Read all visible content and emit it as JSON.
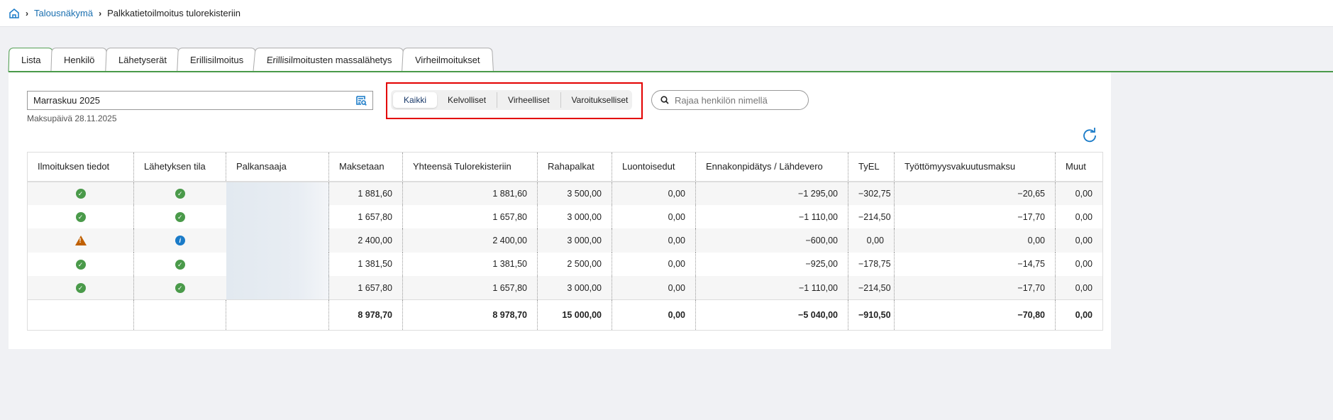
{
  "breadcrumb": {
    "home_icon": "home-icon",
    "parent": "Talousnäkymä",
    "current": "Palkkatietoilmoitus tulorekisteriin"
  },
  "tabs": [
    "Lista",
    "Henkilö",
    "Lähetyserät",
    "Erillisilmoitus",
    "Erillisilmoitusten massalähetys",
    "Virheilmoitukset"
  ],
  "period": {
    "value": "Marraskuu 2025",
    "payday": "Maksupäivä 28.11.2025"
  },
  "filters": [
    "Kaikki",
    "Kelvolliset",
    "Virheelliset",
    "Varoitukselliset"
  ],
  "search": {
    "placeholder": "Rajaa henkilön nimellä"
  },
  "table": {
    "headers": [
      "Ilmoituksen tiedot",
      "Lähetyksen tila",
      "Palkansaaja",
      "Maksetaan",
      "Yhteensä Tulorekisteriin",
      "Rahapalkat",
      "Luontoisedut",
      "Ennakonpidätys / Lähdevero",
      "TyEL",
      "Työttömyysvakuutusmaksu",
      "Muut"
    ],
    "rows": [
      {
        "info": "ok",
        "status": "ok",
        "cells": [
          "1 881,60",
          "1 881,60",
          "3 500,00",
          "0,00",
          "−1 295,00",
          "−302,75",
          "−20,65",
          "0,00"
        ]
      },
      {
        "info": "ok",
        "status": "ok",
        "cells": [
          "1 657,80",
          "1 657,80",
          "3 000,00",
          "0,00",
          "−1 110,00",
          "−214,50",
          "−17,70",
          "0,00"
        ]
      },
      {
        "info": "warning",
        "status": "info",
        "cells": [
          "2 400,00",
          "2 400,00",
          "3 000,00",
          "0,00",
          "−600,00",
          "0,00",
          "0,00",
          "0,00"
        ]
      },
      {
        "info": "ok",
        "status": "ok",
        "cells": [
          "1 381,50",
          "1 381,50",
          "2 500,00",
          "0,00",
          "−925,00",
          "−178,75",
          "−14,75",
          "0,00"
        ]
      },
      {
        "info": "ok",
        "status": "ok",
        "cells": [
          "1 657,80",
          "1 657,80",
          "3 000,00",
          "0,00",
          "−1 110,00",
          "−214,50",
          "−17,70",
          "0,00"
        ]
      }
    ],
    "totals": [
      "8 978,70",
      "8 978,70",
      "15 000,00",
      "0,00",
      "−5 040,00",
      "−910,50",
      "−70,80",
      "0,00"
    ]
  }
}
